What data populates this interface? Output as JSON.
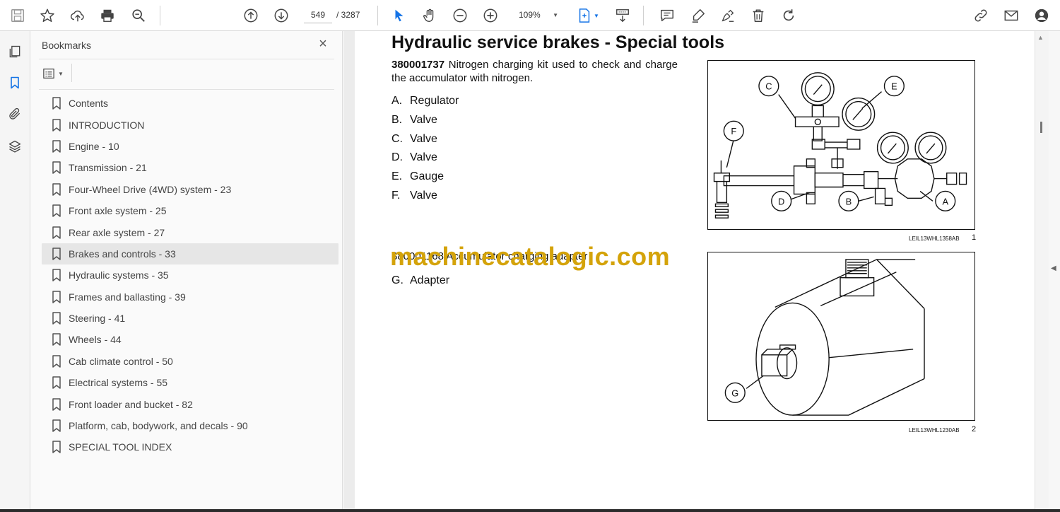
{
  "toolbar": {
    "page_current": "549",
    "page_total": "/ 3287",
    "zoom": "109%"
  },
  "bookmarks": {
    "title": "Bookmarks",
    "close_glyph": "×",
    "items": [
      {
        "label": "Contents"
      },
      {
        "label": "INTRODUCTION"
      },
      {
        "label": "Engine - 10"
      },
      {
        "label": "Transmission - 21"
      },
      {
        "label": "Four-Wheel Drive (4WD) system - 23"
      },
      {
        "label": "Front axle system - 25"
      },
      {
        "label": "Rear axle system - 27"
      },
      {
        "label": "Brakes and controls - 33",
        "selected": true
      },
      {
        "label": "Hydraulic systems - 35"
      },
      {
        "label": "Frames and ballasting - 39"
      },
      {
        "label": "Steering - 41"
      },
      {
        "label": "Wheels - 44"
      },
      {
        "label": "Cab climate control - 50"
      },
      {
        "label": "Electrical systems - 55"
      },
      {
        "label": "Front loader and bucket - 82"
      },
      {
        "label": "Platform, cab, bodywork, and decals - 90"
      },
      {
        "label": "SPECIAL TOOL INDEX"
      }
    ]
  },
  "document": {
    "title": "Hydraulic service brakes - Special tools",
    "tool1_number": "380001737",
    "tool1_desc": " Nitrogen charging kit used to check and charge the accumulator with nitrogen.",
    "parts": [
      {
        "letter": "A.",
        "name": "Regulator"
      },
      {
        "letter": "B.",
        "name": "Valve"
      },
      {
        "letter": "C.",
        "name": "Valve"
      },
      {
        "letter": "D.",
        "name": "Valve"
      },
      {
        "letter": "E.",
        "name": "Gauge"
      },
      {
        "letter": "F.",
        "name": "Valve"
      }
    ],
    "tool2_text": "380001168 Accumulator charging adapter",
    "part_g": {
      "letter": "G.",
      "name": "Adapter"
    },
    "watermark": "machinecatalogic.com",
    "fig1": {
      "code": "LEIL13WHL1358AB",
      "number": "1",
      "labels": {
        "a": "A",
        "b": "B",
        "c": "C",
        "d": "D",
        "e": "E",
        "f": "F"
      }
    },
    "fig2": {
      "code": "LEIL13WHL1230AB",
      "number": "2",
      "labels": {
        "g": "G"
      }
    }
  },
  "icons": {
    "toolbar": [
      "save-icon",
      "star-icon",
      "cloud-upload-icon",
      "print-icon",
      "zoom-search-icon",
      "page-up-icon",
      "page-down-icon",
      "select-cursor-icon",
      "hand-tool-icon",
      "zoom-out-icon",
      "zoom-in-icon",
      "fit-page-icon",
      "scroll-mode-icon",
      "comment-icon",
      "highlight-icon",
      "sign-icon",
      "delete-icon",
      "rotate-icon",
      "link-icon",
      "mail-icon",
      "account-icon"
    ],
    "rail": [
      "pages-icon",
      "bookmark-icon",
      "attachment-icon",
      "layers-icon"
    ]
  },
  "colors": {
    "accent": "#1473e6",
    "watermark": "#d4a30a",
    "selected_bookmark": "#e6e6e6"
  }
}
